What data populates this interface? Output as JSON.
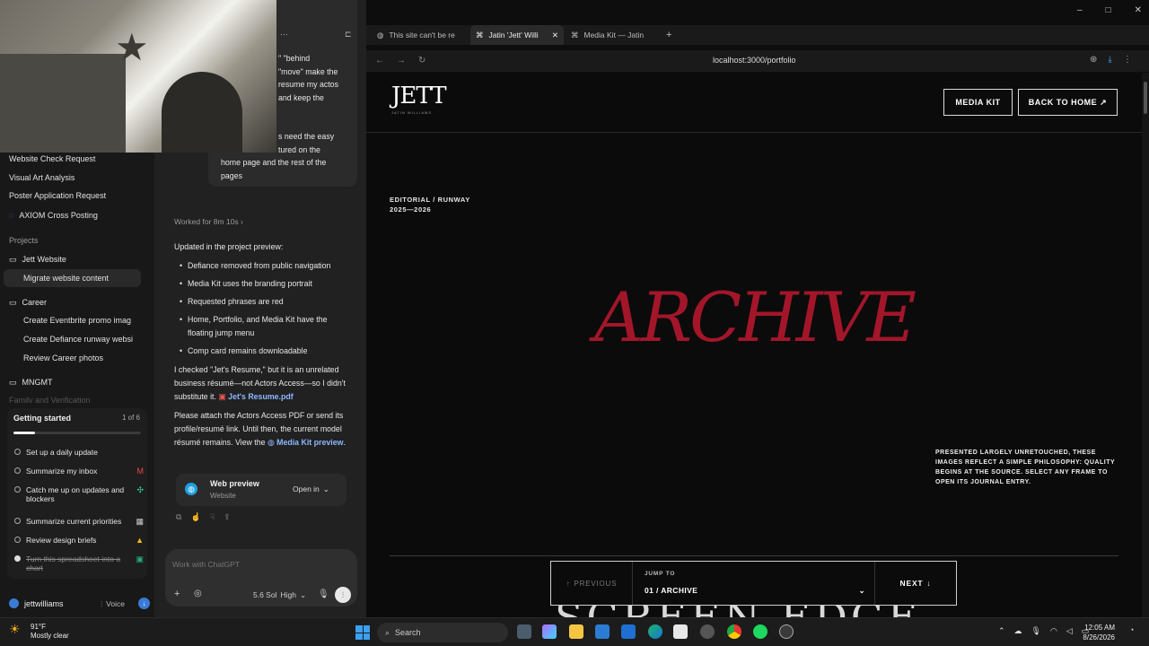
{
  "chat_snippet": {
    "lines": [
      "\" \"behind",
      "\"move\" make the",
      "resume my actos",
      "and keep the",
      "",
      "s need the easy",
      "tured on the",
      "home page and the rest of the",
      "pages"
    ]
  },
  "sidebar": {
    "items": [
      "Website Check Request",
      "Visual Art Analysis",
      "Poster Application Request",
      "AXIOM Cross Posting"
    ],
    "projects_label": "Projects",
    "projects": [
      {
        "label": "Jett Website",
        "children": [
          "Migrate website content"
        ]
      },
      {
        "label": "Career",
        "children": [
          "Create Eventbrite promo imag",
          "Create Defiance runway websi",
          "Review Career photos"
        ]
      },
      {
        "label": "MNGMT",
        "children": []
      }
    ],
    "faded_item": "Family and Verification",
    "getting_started": {
      "title": "Getting started",
      "count": "1 of 6",
      "progress": 0.17,
      "tasks": [
        {
          "label": "Set up a daily update",
          "done": false,
          "icon": ""
        },
        {
          "label": "Summarize my inbox",
          "done": false,
          "icon": "gmail-icon"
        },
        {
          "label": "Catch me up on updates and blockers",
          "done": false,
          "icon": "slack-icon"
        },
        {
          "label": "Summarize current priorities",
          "done": false,
          "icon": "calendar-icon"
        },
        {
          "label": "Review design briefs",
          "done": false,
          "icon": "drive-icon"
        },
        {
          "label": "Turn this spreadsheet into a chart",
          "done": true,
          "icon": "sheets-icon"
        }
      ]
    },
    "user": "jettwilliams",
    "voice_label": "Voice"
  },
  "chat": {
    "worked_for": "Worked for 8m 10s",
    "intro": "Updated in the project preview:",
    "bullets": [
      "Defiance removed from public navigation",
      "Media Kit uses the branding portrait",
      "Requested phrases are red",
      "Home, Portfolio, and Media Kit have the floating jump menu",
      "Comp card remains downloadable"
    ],
    "para1_text": "I checked \"Jet's Resume,\" but it is an unrelated business résumé—not Actors Access—so I didn't substitute it.",
    "para1_link": "Jet's Resume.pdf",
    "para2_text": "Please attach the Actors Access PDF or send its profile/resumé link. Until then, the current model résumé remains. View the",
    "para2_link": "Media Kit preview",
    "preview_card": {
      "title": "Web preview",
      "subtitle": "Website",
      "open_label": "Open in"
    },
    "composer_placeholder": "Work with ChatGPT",
    "model_label": "5.6 Sol",
    "effort_label": "High"
  },
  "browser": {
    "tabs": [
      {
        "title": "This site can't be re",
        "active": false
      },
      {
        "title": "Jatin 'Jett' Willi",
        "active": true
      },
      {
        "title": "Media Kit — Jatin",
        "active": false
      }
    ],
    "url": "localhost:3000/portfolio"
  },
  "site": {
    "logo_text": "JETT",
    "logo_sub": "JATIN WILLIAMS",
    "nav": [
      "MEDIA KIT",
      "BACK TO HOME ↗"
    ],
    "eyebrow_line1": "EDITORIAL / RUNWAY",
    "eyebrow_line2": "2025—2026",
    "headline": "ARCHIVE",
    "philosophy": "PRESENTED LARGELY UNRETOUCHED, THESE IMAGES REFLECT A SIMPLE PHILOSOPHY: QUALITY BEGINS AT THE SOURCE. SELECT ANY FRAME TO OPEN ITS JOURNAL ENTRY.",
    "next_section_peek": "SCREEN EDGE",
    "jump": {
      "previous": "PREVIOUS",
      "label": "JUMP TO",
      "value": "01 / ARCHIVE",
      "next": "NEXT"
    },
    "accent": "#a3162a"
  },
  "taskbar": {
    "weather_temp": "91°F",
    "weather_desc": "Mostly clear",
    "search_placeholder": "Search",
    "time": "12:05 AM",
    "date": "8/26/2026"
  }
}
